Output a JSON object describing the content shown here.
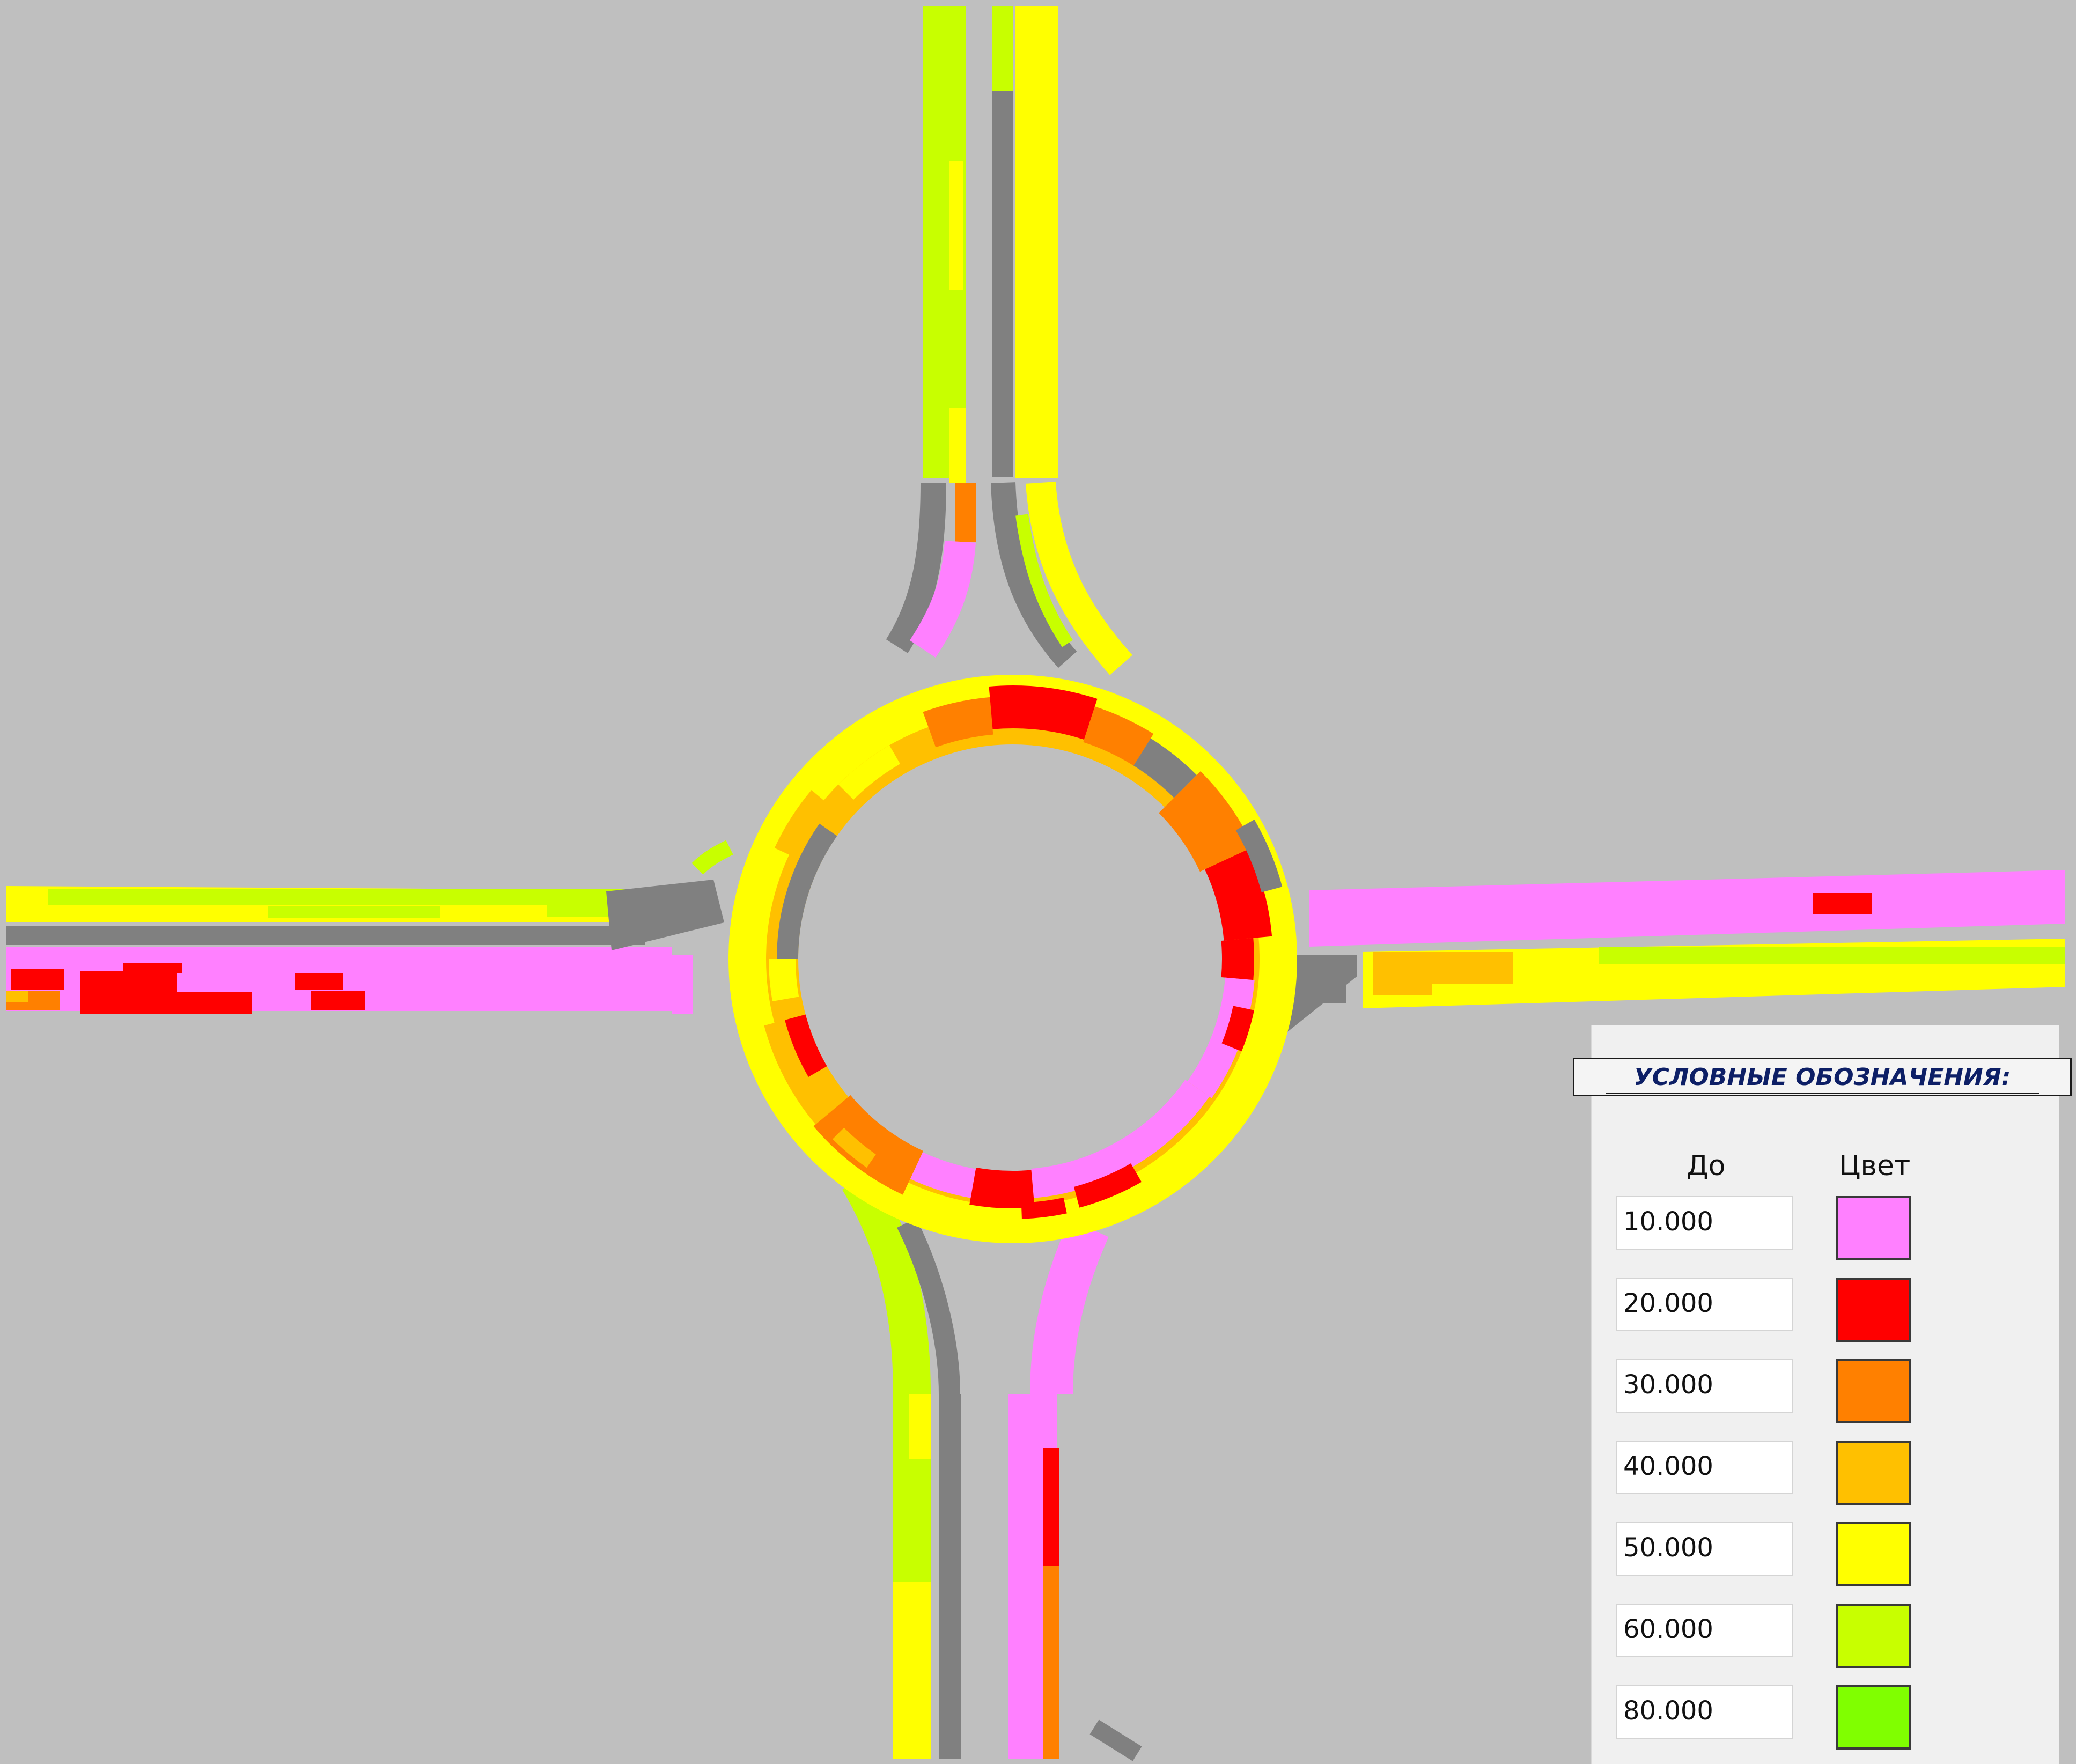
{
  "map": {
    "background_color": "#bfbfbf",
    "unclassified_color": "#808080",
    "segments": [
      {
        "road": "north-inbound",
        "class": 6
      },
      {
        "road": "north-inbound",
        "class": 3
      },
      {
        "road": "north-inbound",
        "class": 1
      },
      {
        "road": "north-outbound",
        "class": 5
      },
      {
        "road": "north-outbound-median",
        "class": 0
      },
      {
        "road": "west-outbound",
        "class": 6
      },
      {
        "road": "west-inbound",
        "class": 1
      },
      {
        "road": "west-inbound",
        "class": 2
      },
      {
        "road": "west-inbound",
        "class": 3
      },
      {
        "road": "east-inbound",
        "class": 1
      },
      {
        "road": "east-inbound",
        "class": 2
      },
      {
        "road": "east-outbound",
        "class": 5
      },
      {
        "road": "east-outbound",
        "class": 6
      },
      {
        "road": "east-outbound",
        "class": 4
      },
      {
        "road": "south-outbound",
        "class": 5
      },
      {
        "road": "south-outbound",
        "class": 6
      },
      {
        "road": "south-inbound",
        "class": 1
      },
      {
        "road": "south-inbound",
        "class": 2
      },
      {
        "road": "south-inbound",
        "class": 3
      },
      {
        "road": "ring-outer",
        "class": 5
      },
      {
        "road": "ring-inner",
        "class": 4
      },
      {
        "road": "ring-inner",
        "class": 2
      },
      {
        "road": "ring-inner",
        "class": 3
      },
      {
        "road": "ring-inner",
        "class": 1
      }
    ]
  },
  "legend": {
    "title": "УСЛОВНЫЕ ОБОЗНАЧЕНИЯ:",
    "col_value": "До",
    "col_color": "Цвет",
    "rows": [
      {
        "value": "10.000",
        "color": "#ff80ff"
      },
      {
        "value": "20.000",
        "color": "#ff0000"
      },
      {
        "value": "30.000",
        "color": "#ff8000"
      },
      {
        "value": "40.000",
        "color": "#ffc000"
      },
      {
        "value": "50.000",
        "color": "#ffff00"
      },
      {
        "value": "60.000",
        "color": "#c8ff00"
      },
      {
        "value": "80.000",
        "color": "#80ff00"
      }
    ]
  }
}
